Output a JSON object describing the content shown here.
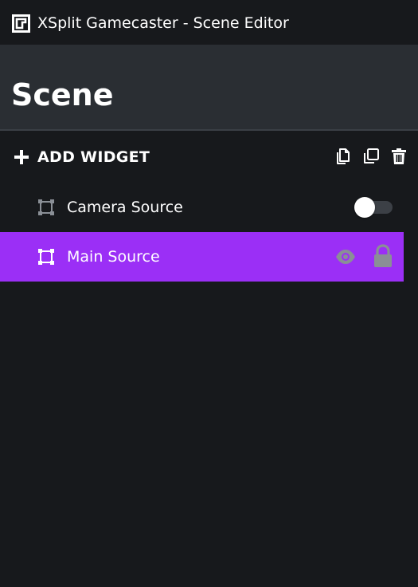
{
  "window": {
    "title": "XSplit Gamecaster - Scene Editor"
  },
  "scene": {
    "title": "Scene"
  },
  "toolbar": {
    "add_widget_label": "ADD WIDGET",
    "icons": [
      "copy-icon",
      "duplicate-icon",
      "trash-icon"
    ]
  },
  "sources": [
    {
      "label": "Camera Source",
      "icon": "source-frame-icon",
      "visible": false,
      "selected": false
    },
    {
      "label": "Main Source",
      "icon": "source-frame-icon",
      "visible": true,
      "locked": true,
      "selected": true
    }
  ],
  "colors": {
    "background": "#17191c",
    "header": "#2a2e33",
    "selected": "#9b2ff6",
    "muted_icon": "#8a8f96",
    "toggle_track": "#3c4046"
  }
}
